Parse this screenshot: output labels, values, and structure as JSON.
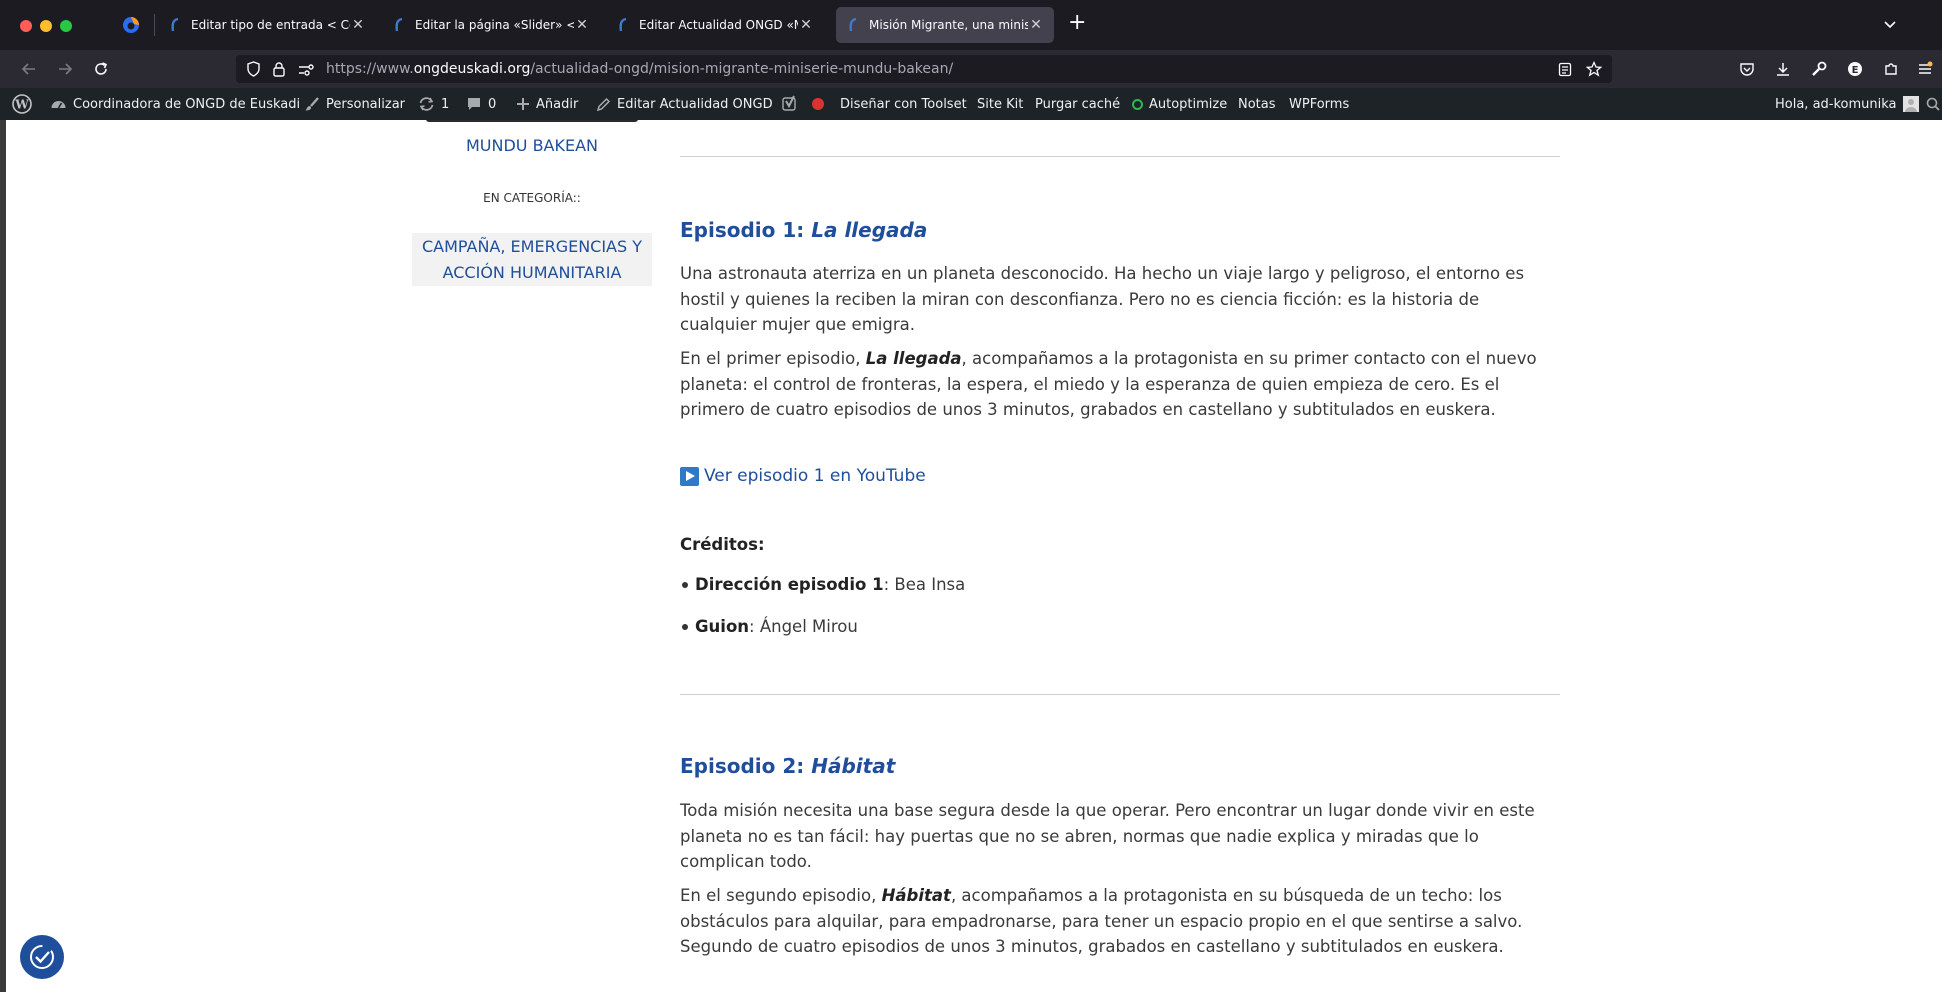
{
  "browser": {
    "tabs": [
      {
        "label": "Editar tipo de entrada < Coordin"
      },
      {
        "label": "Editar la página «Slider» < Coor"
      },
      {
        "label": "Editar Actualidad ONGD «Misión"
      },
      {
        "label": "Misión Migrante, una miniserie d"
      }
    ],
    "url": {
      "prefix": "https://www.",
      "domain": "ongdeuskadi.org",
      "path": "/actualidad-ongd/mision-migrante-miniserie-mundu-bakean/"
    }
  },
  "admin_bar": {
    "site_name": "Coordinadora de ONGD de Euskadi",
    "customize": "Personalizar",
    "updates_count": "1",
    "comments_count": "0",
    "add_new": "Añadir",
    "edit": "Editar Actualidad ONGD",
    "toolset": "Diseñar con Toolset",
    "site_kit": "Site Kit",
    "purge_cache": "Purgar caché",
    "autoptimize": "Autoptimize",
    "notes": "Notas",
    "wpforms": "WPForms",
    "greeting": "Hola, ad-komunika"
  },
  "sidebar": {
    "title_tail": "MUNDU BAKEAN",
    "category_label": "EN CATEGORÍA::",
    "category_value": "CAMPAÑA, EMERGENCIAS Y ACCIÓN HUMANITARIA"
  },
  "episode1": {
    "title_prefix": "Episodio 1: ",
    "title_name": "La llegada",
    "p1": "Una astronauta aterriza en un planeta desconocido. Ha hecho un viaje largo y peligroso, el entorno es hostil y quienes la reciben la miran con desconfianza. Pero no es ciencia ficción: es la historia de cualquier mujer que emigra.",
    "p2_start": "En el primer episodio, ",
    "p2_bold": "La llegada",
    "p2_end": ", acompañamos a la protagonista en su primer contacto con el nuevo planeta: el control de fronteras, la espera, el miedo y la esperanza de quien empieza de cero. Es el primero de cuatro episodios de unos 3 minutos, grabados en castellano y subtitulados en euskera.",
    "link": "Ver episodio 1 en YouTube",
    "credits_label": "Créditos:",
    "credit1_role": "Dirección episodio 1",
    "credit1_name": ": Bea Insa",
    "credit2_role": "Guion",
    "credit2_name": ": Ángel Mirou"
  },
  "episode2": {
    "title_prefix": "Episodio 2: ",
    "title_name": "Hábitat",
    "p1": "Toda misión necesita una base segura desde la que operar. Pero encontrar un lugar donde vivir en este planeta no es tan fácil: hay puertas que no se abren, normas que nadie explica y miradas que lo complican todo.",
    "p2_start": "En el segundo episodio, ",
    "p2_bold": "Hábitat",
    "p2_end": ", acompañamos a la protagonista en su búsqueda de un techo: los obstáculos para alquilar, para empadronarse, para tener un espacio propio en el que sentirse a salvo. Segundo de cuatro episodios de unos 3 minutos, grabados en castellano y subtitulados en euskera."
  },
  "colors": {
    "link": "#1f4e9a",
    "admin_bar": "#1d2327",
    "tab_strip": "#1c1b22",
    "toolbar": "#2b2a33"
  }
}
